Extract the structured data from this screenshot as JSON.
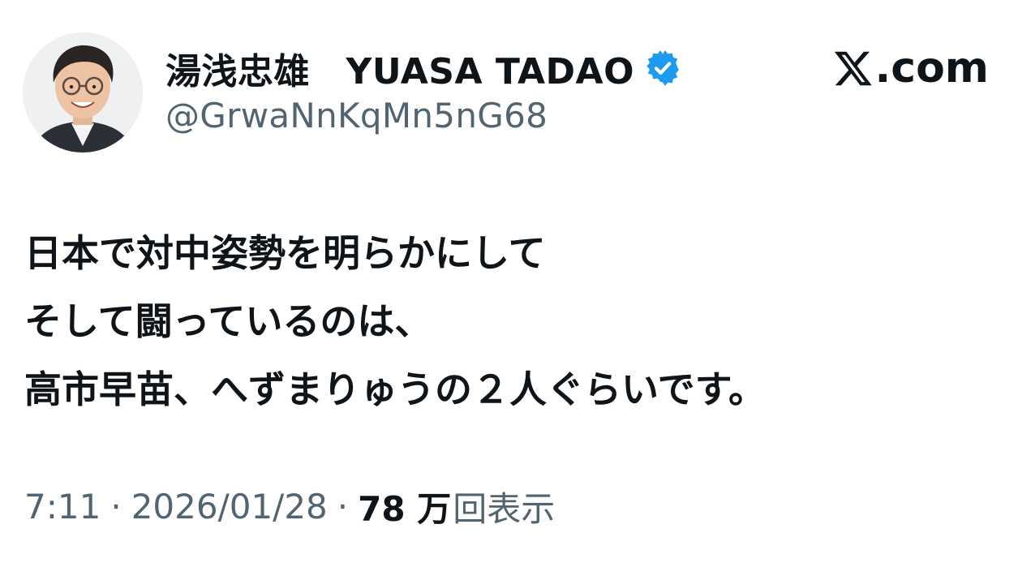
{
  "author": {
    "display_name": "湯浅忠雄　YUASA TADAO",
    "handle": "@GrwaNnKqMn5nG68",
    "verified": true,
    "avatar": "avatar-photo"
  },
  "brand": {
    "logo_icon": "x-logo-icon",
    "domain_suffix": ".com"
  },
  "tweet": {
    "lines": [
      "日本で対中姿勢を明らかにして",
      "そして闘っているのは、",
      "高市早苗、へずまりゅうの２人ぐらいです。"
    ]
  },
  "meta": {
    "time": "7:11",
    "separator": "·",
    "date": "2026/01/28",
    "views_count": "78 万",
    "views_label": "回表示"
  },
  "colors": {
    "text_primary": "#0f1419",
    "text_secondary": "#536471",
    "verified_blue": "#1d9bf0",
    "background": "#ffffff"
  }
}
